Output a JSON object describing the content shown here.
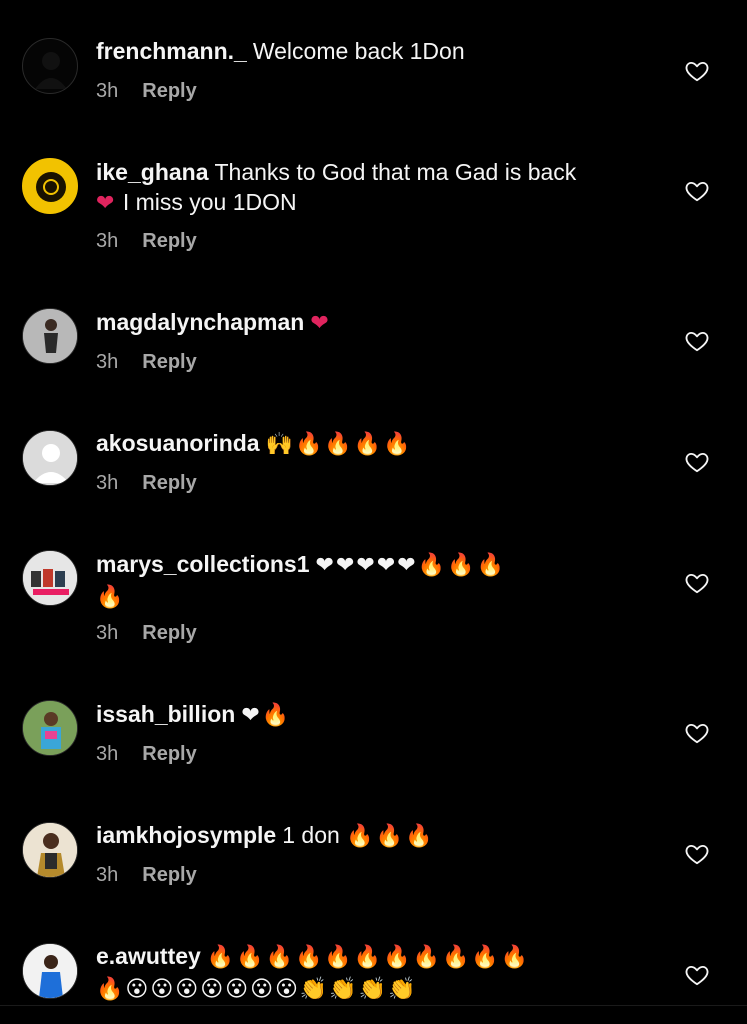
{
  "comments": [
    {
      "username": "frenchmann._",
      "text": "Welcome back 1Don",
      "emoji": "",
      "time": "3h",
      "reply": "Reply"
    },
    {
      "username": "ike_ghana",
      "text": "Thanks to God that ma Gad is back",
      "emoji": "❤",
      "text2": "I miss you 1DON",
      "time": "3h",
      "reply": "Reply"
    },
    {
      "username": "magdalynchapman",
      "text": "",
      "emoji": "❤",
      "time": "3h",
      "reply": "Reply"
    },
    {
      "username": "akosuanorinda",
      "text": "",
      "emoji": "🙌🔥🔥🔥🔥",
      "time": "3h",
      "reply": "Reply"
    },
    {
      "username": "marys_collections1",
      "text": "",
      "emoji": "❤❤❤❤❤🔥🔥🔥",
      "emoji2": "🔥",
      "time": "3h",
      "reply": "Reply"
    },
    {
      "username": "issah_billion",
      "text": "",
      "emoji": "❤🔥",
      "time": "3h",
      "reply": "Reply"
    },
    {
      "username": "iamkhojosymple",
      "text": "1 don",
      "emoji": "🔥🔥🔥",
      "time": "3h",
      "reply": "Reply"
    },
    {
      "username": "e.awuttey",
      "text": "",
      "emoji": "🔥🔥🔥🔥🔥🔥🔥🔥🔥🔥🔥",
      "emoji2": "🔥😮😮😮😮😮😮😮👏👏👏👏",
      "time": "",
      "reply": ""
    }
  ],
  "icons": {
    "like": "heart-outline-icon",
    "accent_heart": "#e0245e",
    "muted": "#a8a8a8"
  }
}
